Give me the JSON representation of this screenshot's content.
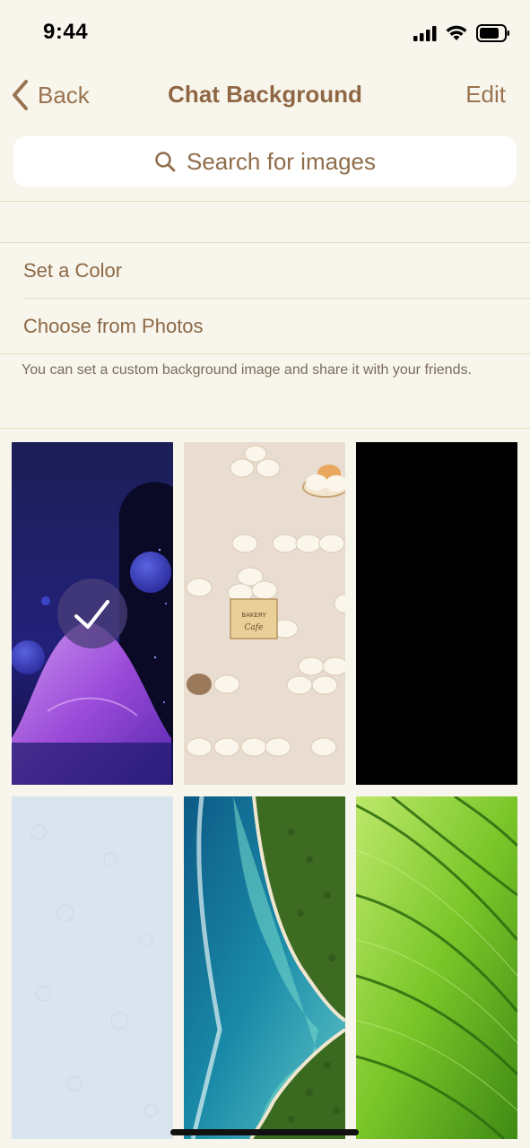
{
  "status_bar": {
    "time": "9:44"
  },
  "nav": {
    "back_label": "Back",
    "title": "Chat Background",
    "edit_label": "Edit"
  },
  "search": {
    "placeholder": "Search for images"
  },
  "menu": {
    "set_color": "Set a Color",
    "choose_photos": "Choose from Photos"
  },
  "hint": "You can set a custom background image and share it with your friends.",
  "wallpapers": {
    "selected_index": 0,
    "bakery_sign_line1": "BAKERY",
    "bakery_sign_line2": "Cafe"
  },
  "colors": {
    "background": "#f8f6ec",
    "accent": "#9a7451",
    "divider": "#e6d9c1"
  }
}
